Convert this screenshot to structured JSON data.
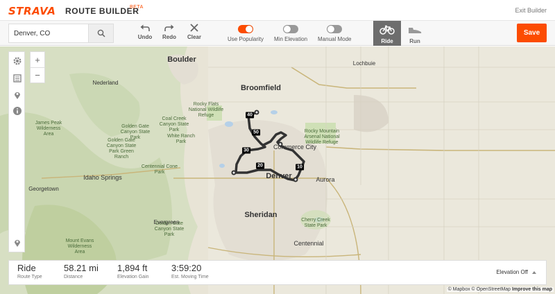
{
  "header": {
    "logo": "STRAVA",
    "title": "ROUTE BUILDER",
    "beta": "BETA",
    "exit": "Exit Builder"
  },
  "toolbar": {
    "search_value": "Denver, CO",
    "undo": "Undo",
    "redo": "Redo",
    "clear": "Clear",
    "use_popularity": {
      "label": "Use Popularity",
      "on": true
    },
    "min_elevation": {
      "label": "Min Elevation",
      "on": false
    },
    "manual_mode": {
      "label": "Manual Mode",
      "on": false
    },
    "ride": "Ride",
    "run": "Run",
    "save": "Save",
    "accent_color": "#fc4c02"
  },
  "map": {
    "cities": {
      "boulder": "Boulder",
      "broomfield": "Broomfield",
      "denver": "Denver",
      "aurora": "Aurora",
      "sheridan": "Sheridan",
      "commerce_city": "Commerce City",
      "centennial": "Centennial",
      "lochbuie": "Lochbuie",
      "evergreen": "Evergreen",
      "idaho_springs": "Idaho Springs",
      "georgetown": "Georgetown",
      "nederland": "Nederland"
    },
    "parks": {
      "rocky_flats": "Rocky Flats\nNational Wildlife\nRefuge",
      "rocky_mountain_arsenal": "Rocky Mountain\nArsenal National\nWildlife Refuge",
      "james_peak": "James Peak\nWilderness\nArea",
      "golden_gate": "Golden Gate\nCanyon State\nPark",
      "coal_creek": "Coal Creek\nCanyon State\nPark",
      "white_ranch": "White Ranch\nPark",
      "golden_gate_ranch": "Golden Gate\nCanyon State\nPark Green\nRanch",
      "centennial_cone": "Centennial Cone\nPark",
      "golden_gate_2": "Golden Gate\nCanyon State\nPark",
      "cherry_creek": "Cherry Creek\nState Park",
      "mount_evans": "Mount Evans\nWilderness\nArea"
    },
    "markers": [
      "40",
      "50",
      "30",
      "20",
      "10"
    ],
    "route_color": "#333333"
  },
  "stats": {
    "sport": {
      "value": "Ride",
      "label": "Route Type"
    },
    "distance": {
      "value": "58.21 mi",
      "label": "Distance"
    },
    "elevation": {
      "value": "1,894 ft",
      "label": "Elevation Gain"
    },
    "time": {
      "value": "3:59:20",
      "label": "Est. Moving Time"
    },
    "elevation_toggle": "Elevation Off"
  },
  "attribution": {
    "mapbox": "© Mapbox",
    "osm": "© OpenStreetMap",
    "improve": "Improve this map"
  }
}
